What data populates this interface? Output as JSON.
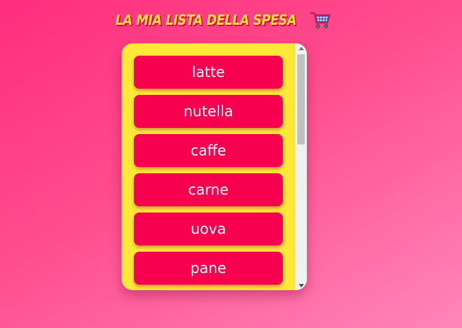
{
  "header": {
    "title": "La mia lista della spesa",
    "title_icon": "shopping-cart-icon"
  },
  "list": {
    "items": [
      {
        "label": "latte"
      },
      {
        "label": "nutella"
      },
      {
        "label": "caffe"
      },
      {
        "label": "carne"
      },
      {
        "label": "uova"
      },
      {
        "label": "pane"
      }
    ]
  },
  "colors": {
    "background_start": "#ff2d7e",
    "background_end": "#ff86bb",
    "panel": "#ffe838",
    "item": "#f6004f",
    "title": "#ffe135"
  }
}
